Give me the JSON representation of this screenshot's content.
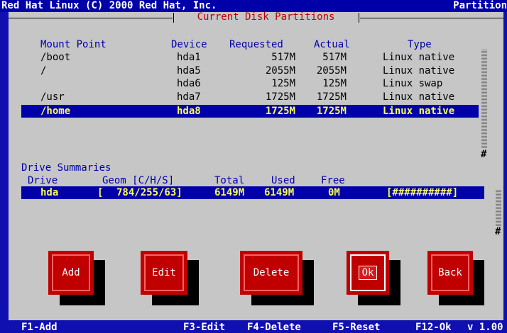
{
  "topbar": {
    "left_text": "Red Hat Linux (C) 2000 Red Hat, Inc.",
    "right_text": "Partition"
  },
  "panel": {
    "title": "Current Disk Partitions"
  },
  "partitions": {
    "headers": {
      "mount": "Mount Point",
      "device": "Device",
      "requested": "Requested",
      "actual": "Actual",
      "type": "Type"
    },
    "rows": [
      {
        "mount": "/boot",
        "device": "hda1",
        "requested": "517M",
        "actual": "517M",
        "type": "Linux native"
      },
      {
        "mount": "/",
        "device": "hda5",
        "requested": "2055M",
        "actual": "2055M",
        "type": "Linux native"
      },
      {
        "mount": "",
        "device": "hda6",
        "requested": "125M",
        "actual": "125M",
        "type": "Linux swap"
      },
      {
        "mount": "/usr",
        "device": "hda7",
        "requested": "1725M",
        "actual": "1725M",
        "type": "Linux native"
      }
    ],
    "selected": {
      "mount": "/home",
      "device": "hda8",
      "requested": "1725M",
      "actual": "1725M",
      "type": "Linux native"
    }
  },
  "drives": {
    "section_title": "Drive Summaries",
    "headers": {
      "drive": "Drive",
      "geom": "Geom [C/H/S]",
      "total": "Total",
      "used": "Used",
      "free": "Free"
    },
    "row": {
      "drive": "hda",
      "geom_open": "[",
      "geom": "784/255/63]",
      "total": "6149M",
      "used": "6149M",
      "free": "0M",
      "bar": "[##########]"
    }
  },
  "scroll_marker": "#",
  "buttons": {
    "add": "Add",
    "edit": "Edit",
    "delete": "Delete",
    "ok": "Ok",
    "back": "Back"
  },
  "bottombar": {
    "f1": "F1-Add",
    "f3": "F3-Edit",
    "f4": "F4-Delete",
    "f5": "F5-Reset",
    "f12": "F12-Ok",
    "version": "v 1.00"
  },
  "colors": {
    "screen_bg": "#1010b0",
    "panel_bg": "#c6c6c6",
    "header_text": "#0000a8",
    "selected_bg": "#0000a8",
    "selected_text": "#ffff55",
    "button_bg": "#c00000",
    "title_text": "#c00000"
  }
}
